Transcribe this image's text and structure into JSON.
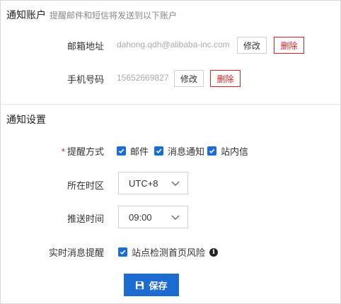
{
  "account": {
    "title": "通知账户",
    "description": "提醒邮件和短信将发送到以下账户",
    "email": {
      "label": "邮箱地址",
      "value": "dahong.qdh@alibaba-inc.com",
      "edit": "修改",
      "delete": "删除"
    },
    "phone": {
      "label": "手机号码",
      "value": "15652669827",
      "edit": "修改",
      "delete": "删除"
    }
  },
  "settings": {
    "title": "通知设置",
    "method": {
      "label": "提醒方式",
      "required": "*",
      "options": [
        {
          "label": "邮件",
          "checked": true
        },
        {
          "label": "消息通知",
          "checked": true
        },
        {
          "label": "站内信",
          "checked": true
        }
      ]
    },
    "timezone": {
      "label": "所在时区",
      "value": "UTC+8"
    },
    "push_time": {
      "label": "推送时间",
      "value": "09:00"
    },
    "realtime": {
      "label": "实时消息提醒",
      "option": "站点检测首页风险",
      "checked": true,
      "info_icon": "info-icon"
    }
  },
  "save": {
    "label": "保存",
    "icon": "save-icon"
  },
  "colors": {
    "primary": "#1c6bd0",
    "danger": "#e0201f",
    "checkbox": "#1a6dd8"
  }
}
